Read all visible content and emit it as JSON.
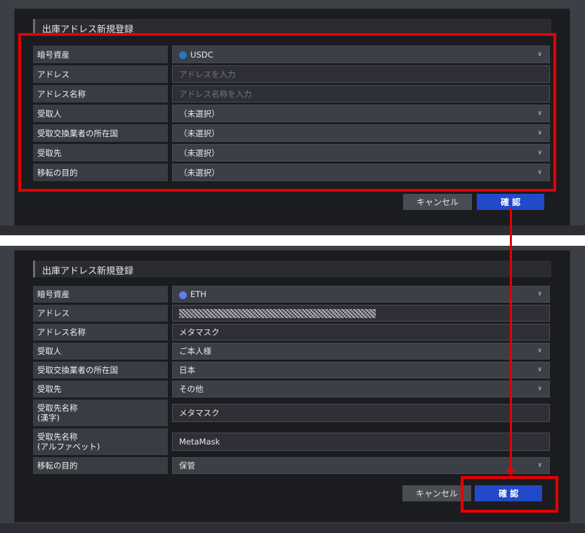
{
  "screens": [
    {
      "dialog_title": "出庫アドレス新規登録",
      "fields": [
        {
          "label": "暗号資産",
          "value": "USDC",
          "type": "select",
          "coin": "usdc"
        },
        {
          "label": "アドレス",
          "placeholder": "アドレスを入力",
          "type": "input"
        },
        {
          "label": "アドレス名称",
          "placeholder": "アドレス名称を入力",
          "type": "input"
        },
        {
          "label": "受取人",
          "value": "（未選択）",
          "type": "select"
        },
        {
          "label": "受取交換業者の所在国",
          "value": "（未選択）",
          "type": "select"
        },
        {
          "label": "受取先",
          "value": "（未選択）",
          "type": "select"
        },
        {
          "label": "移転の目的",
          "value": "（未選択）",
          "type": "select"
        }
      ],
      "cancel_label": "キャンセル",
      "confirm_label": "確 認"
    },
    {
      "dialog_title": "出庫アドレス新規登録",
      "fields": [
        {
          "label": "暗号資産",
          "value": "ETH",
          "type": "select",
          "coin": "eth"
        },
        {
          "label": "アドレス",
          "value": "",
          "type": "masked"
        },
        {
          "label": "アドレス名称",
          "value": "メタマスク",
          "type": "input"
        },
        {
          "label": "受取人",
          "value": "ご本人様",
          "type": "select"
        },
        {
          "label": "受取交換業者の所在国",
          "value": "日本",
          "type": "select"
        },
        {
          "label": "受取先",
          "value": "その他",
          "type": "select"
        },
        {
          "label": "受取先名称\n(漢字)",
          "value": "メタマスク",
          "type": "input",
          "tall": true
        },
        {
          "label": "受取先名称\n(アルファベット)",
          "value": "MetaMask",
          "type": "input",
          "tall": true
        },
        {
          "label": "移転の目的",
          "value": "保管",
          "type": "select"
        }
      ],
      "cancel_label": "キャンセル",
      "confirm_label": "確 認"
    }
  ],
  "colors": {
    "highlight": "#e60000",
    "confirm_button": "#2249c9",
    "usdc_icon": "#2775ca",
    "eth_icon": "#627eea"
  },
  "icons": {
    "select_chevron": "chevron-down-icon",
    "usdc": "usdc-coin-icon",
    "eth": "eth-coin-icon"
  }
}
